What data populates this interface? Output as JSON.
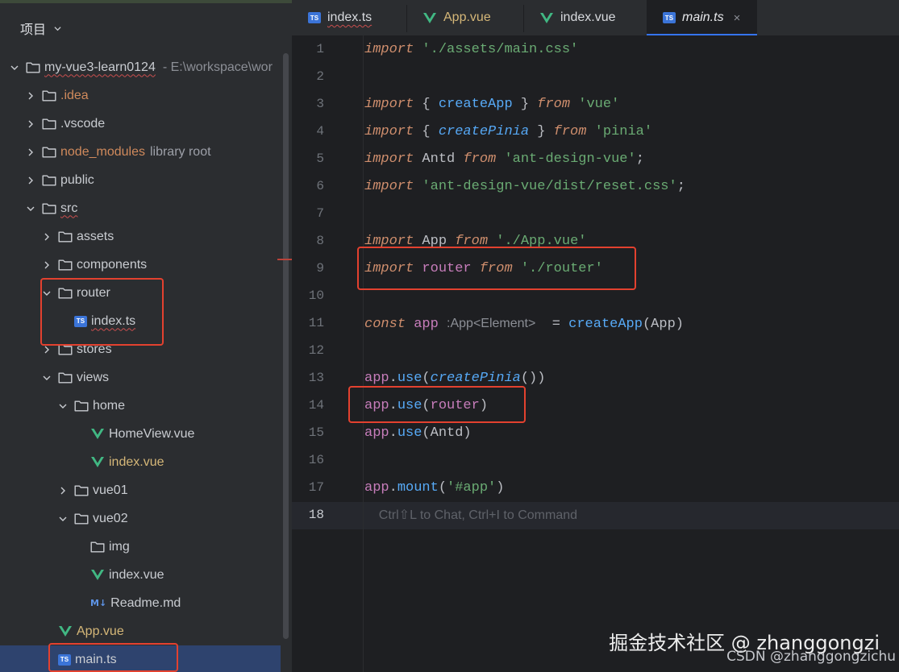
{
  "panel": {
    "title": "项目"
  },
  "tree": [
    {
      "label": "my-vue3-learn0124",
      "path": "- E:\\workspace\\wor",
      "depth": 0,
      "icon": "folder",
      "arrow": "down",
      "style": "red-wavy"
    },
    {
      "label": ".idea",
      "depth": 1,
      "icon": "folder",
      "arrow": "right",
      "style": "excluded"
    },
    {
      "label": ".vscode",
      "depth": 1,
      "icon": "folder",
      "arrow": "right"
    },
    {
      "label": "node_modules",
      "note": "library root",
      "depth": 1,
      "icon": "folder",
      "arrow": "right",
      "style": "excluded"
    },
    {
      "label": "public",
      "depth": 1,
      "icon": "folder",
      "arrow": "right"
    },
    {
      "label": "src",
      "depth": 1,
      "icon": "folder",
      "arrow": "down",
      "style": "red-wavy"
    },
    {
      "label": "assets",
      "depth": 2,
      "icon": "folder",
      "arrow": "right"
    },
    {
      "label": "components",
      "depth": 2,
      "icon": "folder",
      "arrow": "right"
    },
    {
      "label": "router",
      "depth": 2,
      "icon": "folder",
      "arrow": "down"
    },
    {
      "label": "index.ts",
      "depth": 3,
      "icon": "ts",
      "arrow": "none",
      "style": "red-wavy"
    },
    {
      "label": "stores",
      "depth": 2,
      "icon": "folder",
      "arrow": "right"
    },
    {
      "label": "views",
      "depth": 2,
      "icon": "folder",
      "arrow": "down"
    },
    {
      "label": "home",
      "depth": 3,
      "icon": "folder",
      "arrow": "down"
    },
    {
      "label": "HomeView.vue",
      "depth": 4,
      "icon": "vue",
      "arrow": "none"
    },
    {
      "label": "index.vue",
      "depth": 4,
      "icon": "vue",
      "arrow": "none",
      "style": "modified"
    },
    {
      "label": "vue01",
      "depth": 3,
      "icon": "folder",
      "arrow": "right"
    },
    {
      "label": "vue02",
      "depth": 3,
      "icon": "folder",
      "arrow": "down"
    },
    {
      "label": "img",
      "depth": 4,
      "icon": "folder",
      "arrow": "none"
    },
    {
      "label": "index.vue",
      "depth": 4,
      "icon": "vue",
      "arrow": "none"
    },
    {
      "label": "Readme.md",
      "depth": 4,
      "icon": "md",
      "arrow": "none"
    },
    {
      "label": "App.vue",
      "depth": 2,
      "icon": "vue",
      "arrow": "none",
      "style": "modified"
    },
    {
      "label": "main.ts",
      "depth": 2,
      "icon": "ts",
      "arrow": "none",
      "selected": true
    }
  ],
  "tabs": [
    {
      "label": "index.ts",
      "icon": "ts",
      "style": "red-wavy"
    },
    {
      "label": "App.vue",
      "icon": "vue",
      "style": "modified"
    },
    {
      "label": "index.vue",
      "icon": "vue"
    },
    {
      "label": "main.ts",
      "icon": "ts",
      "active": true,
      "close": "×"
    }
  ],
  "code": [
    [
      [
        "kw",
        "import"
      ],
      [
        "plain",
        " "
      ],
      [
        "str",
        "'./assets/main.css'"
      ]
    ],
    [],
    [
      [
        "kw",
        "import"
      ],
      [
        "plain",
        " { "
      ],
      [
        "fn",
        "createApp"
      ],
      [
        "plain",
        " } "
      ],
      [
        "kw",
        "from"
      ],
      [
        "plain",
        " "
      ],
      [
        "str",
        "'vue'"
      ]
    ],
    [
      [
        "kw",
        "import"
      ],
      [
        "plain",
        " { "
      ],
      [
        "fni",
        "createPinia"
      ],
      [
        "plain",
        " } "
      ],
      [
        "kw",
        "from"
      ],
      [
        "plain",
        " "
      ],
      [
        "str",
        "'pinia'"
      ]
    ],
    [
      [
        "kw",
        "import"
      ],
      [
        "plain",
        " Antd "
      ],
      [
        "kw",
        "from"
      ],
      [
        "plain",
        " "
      ],
      [
        "str",
        "'ant-design-vue'"
      ],
      [
        "plain",
        ";"
      ]
    ],
    [
      [
        "kw",
        "import"
      ],
      [
        "plain",
        " "
      ],
      [
        "str",
        "'ant-design-vue/dist/reset.css'"
      ],
      [
        "plain",
        ";"
      ]
    ],
    [],
    [
      [
        "kw",
        "import"
      ],
      [
        "plain",
        " App "
      ],
      [
        "kw",
        "from"
      ],
      [
        "plain",
        " "
      ],
      [
        "str",
        "'./App.vue'"
      ]
    ],
    [
      [
        "kw",
        "import"
      ],
      [
        "plain",
        " "
      ],
      [
        "var",
        "router"
      ],
      [
        "plain",
        " "
      ],
      [
        "kw",
        "from"
      ],
      [
        "plain",
        " "
      ],
      [
        "str",
        "'./router'"
      ]
    ],
    [],
    [
      [
        "kw",
        "const"
      ],
      [
        "plain",
        " "
      ],
      [
        "var",
        "app"
      ],
      [
        "plain",
        " "
      ],
      [
        "hint",
        ":App<Element>"
      ],
      [
        "plain",
        "  = "
      ],
      [
        "fn",
        "createApp"
      ],
      [
        "plain",
        "(App)"
      ]
    ],
    [],
    [
      [
        "var",
        "app"
      ],
      [
        "plain",
        "."
      ],
      [
        "fn",
        "use"
      ],
      [
        "plain",
        "("
      ],
      [
        "fni",
        "createPinia"
      ],
      [
        "plain",
        "())"
      ]
    ],
    [
      [
        "var",
        "app"
      ],
      [
        "plain",
        "."
      ],
      [
        "fn",
        "use"
      ],
      [
        "plain",
        "("
      ],
      [
        "var",
        "router"
      ],
      [
        "plain",
        ")"
      ]
    ],
    [
      [
        "var",
        "app"
      ],
      [
        "plain",
        "."
      ],
      [
        "fn",
        "use"
      ],
      [
        "plain",
        "(Antd)"
      ]
    ],
    [],
    [
      [
        "var",
        "app"
      ],
      [
        "plain",
        "."
      ],
      [
        "fn",
        "mount"
      ],
      [
        "plain",
        "("
      ],
      [
        "str",
        "'#app'"
      ],
      [
        "plain",
        ")"
      ]
    ],
    [
      [
        "ghost",
        "    Ctrl⇧L to Chat, Ctrl+I to Command"
      ]
    ]
  ],
  "current_line": 18,
  "watermark": {
    "primary": "掘金技术社区 @ zhanggongzi",
    "secondary": "CSDN @zhanggongzichu"
  },
  "colors": {
    "accent": "#3574f0",
    "highlight_box": "#e3412f",
    "vue": "#41b883",
    "ts": "#3b74d8"
  }
}
